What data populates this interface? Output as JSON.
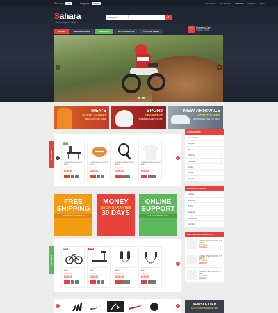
{
  "topbar": {
    "currency_label": "Currency:",
    "currency_value": "USD",
    "language_label": "Language:",
    "language_value": "English",
    "links": [
      "My Account",
      "My Wishlist",
      "Checkout",
      "Register",
      "Log In"
    ]
  },
  "header": {
    "logo_first": "S",
    "logo_rest": "ahara",
    "tagline": "The Best Magento Theme",
    "search_category": "Categories",
    "cart_title": "Shopping Cart",
    "cart_items": "0 item(s) - $0.00"
  },
  "nav": {
    "items": [
      "HOME",
      "NEW ARRIVALS",
      "SPECIALS",
      "ALL PRODUCTS",
      "CUSTOM MENU"
    ]
  },
  "banners": [
    {
      "line1": "MEN'S",
      "line2": "SPORT JACKET",
      "line3": "NEW LOOK ONLY $39.00"
    },
    {
      "line1": "SPORT",
      "line2": "HEADWEAR",
      "line3": "SUMMER COLLECTION 2014"
    },
    {
      "line1": "NEW ARRIVALS",
      "line2": "SPORT SHOES",
      "line3": "RUNNING ALL TIME TOP NIGHT"
    }
  ],
  "sidebar": {
    "categories_title": "CATEGORIES",
    "categories": [
      "Accessories",
      "Bicycles",
      "Bikes",
      "Clothing",
      "Football",
      "Optics",
      "Shoes",
      "Weights"
    ],
    "manufacturers_title": "MANUFACTURERS",
    "manufacturers": [
      "Adidas",
      "Nike Air",
      "Puma",
      "Reebok",
      "Luk & Duff",
      "Ck Nice"
    ],
    "bestsellers_title": "BESTSELLER PRODUCTS",
    "bestsellers": [
      {
        "name": "LOREM IPSUM DOLOR SIT AMET",
        "stars": "★★★★★",
        "price": "$250.00"
      },
      {
        "name": "LOREM IPSUM DOLOR SIT AMET",
        "stars": "★★★★★",
        "price": "$250.00"
      },
      {
        "name": "LOREM IPSUM DOLOR SIT AMET",
        "stars": "★★★★★",
        "price": "$250.00"
      }
    ]
  },
  "featured": {
    "tab_label": "FEATURED",
    "products": [
      {
        "badge": "NEW",
        "name": "LOREM IPSUM DOLOR SIT AMET",
        "stars": "★★★★★",
        "price": "$250.00"
      },
      {
        "badge": "",
        "name": "LOREM IPSUM DOLOR SIT AMET",
        "stars": "★★★★★",
        "price": "$250.00"
      },
      {
        "badge": "",
        "name": "LOREM IPSUM DOLOR SIT AMET",
        "stars": "★★★★★",
        "price": "$250.00"
      },
      {
        "badge": "",
        "name": "LOREM IPSUM DOLOR SIT AMET",
        "stars": "★★★★★",
        "price": "$250.00"
      }
    ]
  },
  "promos": [
    {
      "line1": "FREE",
      "line2": "SHIPPING",
      "line3": "ON ORDERS OVER $99.00"
    },
    {
      "line1": "MONEY",
      "line2": "BACK GARANTEE",
      "line3": "30 DAYS"
    },
    {
      "line1": "ONLINE",
      "line2": "SUPPORT",
      "line3": "ONLINE SUPPORT 24/24"
    }
  ],
  "specials": {
    "tab_label": "SPECIALS",
    "products": [
      {
        "badge": "NEW",
        "name": "LOREM IPSUM DOLOR SIT AMET",
        "stars": "★★★★★",
        "price": "$250.00"
      },
      {
        "badge": "SALE",
        "name": "LOREM IPSUM DOLOR SIT AMET",
        "stars": "★★★★★",
        "price": "$250.00"
      },
      {
        "badge": "",
        "name": "LOREM IPSUM DOLOR SIT AMET",
        "stars": "★★★★★",
        "price": "$250.00"
      },
      {
        "badge": "",
        "name": "LOREM IPSUM DOLOR SIT AMET",
        "stars": "★★★★★",
        "price": "$250.00"
      }
    ]
  },
  "newsletter": {
    "title": "NEWSLETTER",
    "subtitle": "SIGN UP FOR OUR NEWSLETTER"
  },
  "colors": {
    "accent": "#e8413b",
    "green": "#5cb85c",
    "orange": "#f39c12",
    "dark": "#3a3f4d"
  }
}
